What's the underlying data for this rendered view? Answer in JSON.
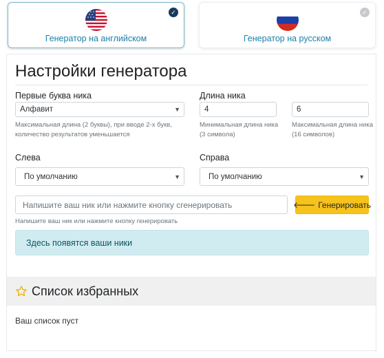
{
  "language_switch": {
    "english": {
      "label": "Генератор на английском",
      "flag_icon": "us-flag-icon",
      "selected": true
    },
    "russian": {
      "label": "Генератор на русском",
      "flag_icon": "ru-flag-icon",
      "selected": false
    }
  },
  "settings": {
    "title": "Настройки генератора",
    "first_letters": {
      "label": "Первые буква ника",
      "selected": "Алфавит",
      "help": "Максимальная длина (2 буквы), при вводе 2-х букв, количество результатов уменьшается"
    },
    "length": {
      "label": "Длина ника",
      "min_value": "4",
      "min_help": "Минимальная длина ника (3 символа)",
      "max_value": "6",
      "max_help": "Максимальная длина ника (16 символов)"
    },
    "left": {
      "label": "Слева",
      "selected": "По умолчанию"
    },
    "right": {
      "label": "Справа",
      "selected": "По умолчанию"
    },
    "nick_input": {
      "placeholder": "Напишите ваш ник или нажмите кнопку сгенерировать",
      "help": "Напишите ваш ник или нажмите кнопку генерировать"
    },
    "generate_button": {
      "label": "Генерировать",
      "icon": "arrow-left-icon"
    },
    "result_text": "Здесь появятся ваши ники"
  },
  "favorites": {
    "icon": "star-icon",
    "title": "Список избранных",
    "empty_text": "Ваш список пуст"
  },
  "colors": {
    "accent": "#1a7fa8",
    "button": "#f6c21c",
    "alert_bg": "#d1ecf1",
    "alert_text": "#0c5460"
  }
}
